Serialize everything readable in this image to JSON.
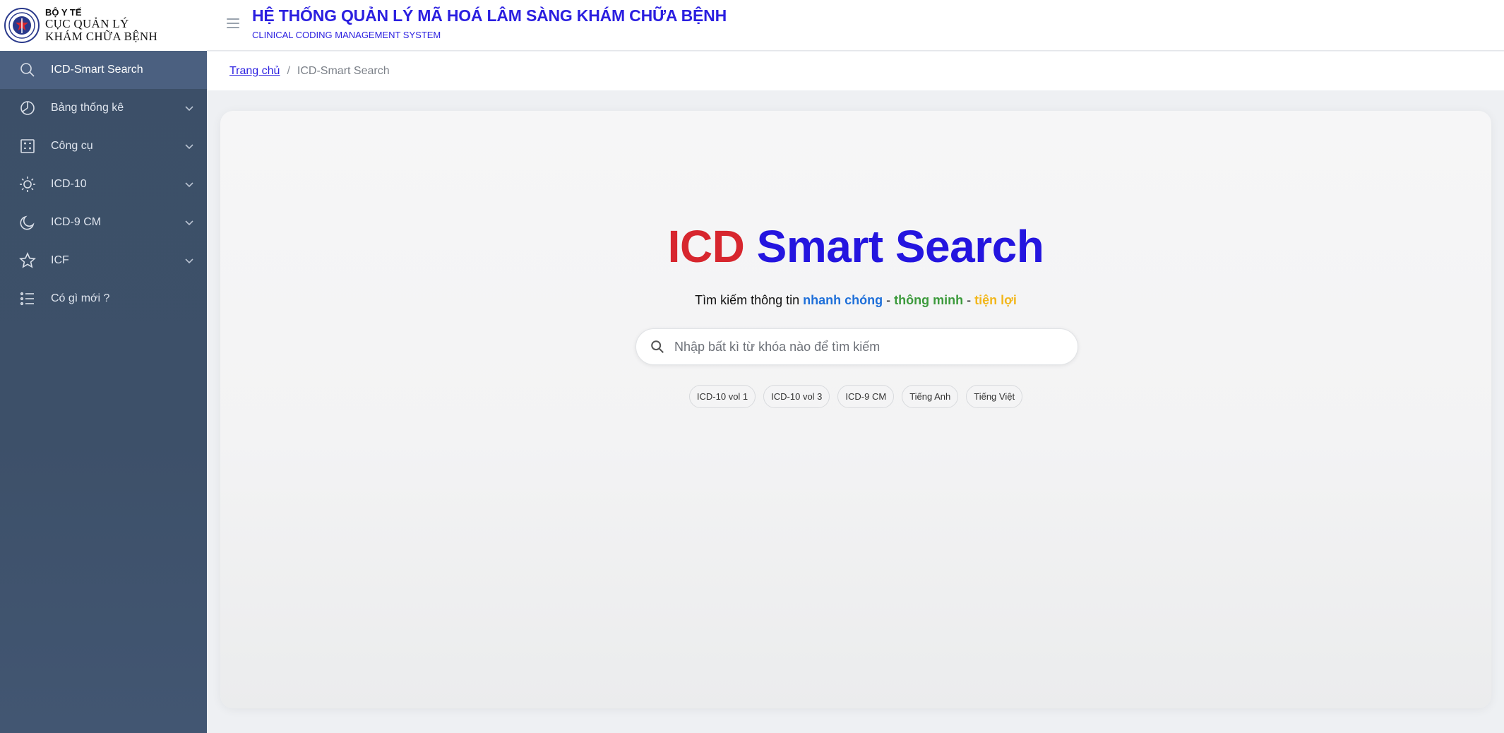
{
  "logo": {
    "line1": "BỘ Y TẾ",
    "line2": "CỤC QUẢN LÝ",
    "line3": "KHÁM CHỮA BỆNH"
  },
  "header": {
    "title": "HỆ THỐNG QUẢN LÝ MÃ HOÁ LÂM SÀNG KHÁM CHỮA BỆNH",
    "subtitle": "CLINICAL CODING MANAGEMENT SYSTEM"
  },
  "sidebar": {
    "items": [
      {
        "label": "ICD-Smart Search",
        "icon": "search-icon",
        "active": true,
        "expandable": false
      },
      {
        "label": "Bảng thống kê",
        "icon": "pie-chart-icon",
        "active": false,
        "expandable": true
      },
      {
        "label": "Công cụ",
        "icon": "tools-grid-icon",
        "active": false,
        "expandable": true
      },
      {
        "label": "ICD-10",
        "icon": "sun-icon",
        "active": false,
        "expandable": true
      },
      {
        "label": "ICD-9 CM",
        "icon": "moon-icon",
        "active": false,
        "expandable": true
      },
      {
        "label": "ICF",
        "icon": "star-icon",
        "active": false,
        "expandable": true
      },
      {
        "label": "Có gì mới ?",
        "icon": "list-icon",
        "active": false,
        "expandable": false
      }
    ]
  },
  "breadcrumb": {
    "home": "Trang chủ",
    "separator": "/",
    "current": "ICD-Smart Search"
  },
  "hero": {
    "title_part1": "ICD",
    "title_part2": "Smart Search",
    "tagline_prefix": "Tìm kiếm thông tin ",
    "tagline_word1": "nhanh chóng",
    "tagline_sep1": " - ",
    "tagline_word2": "thông minh",
    "tagline_sep2": " - ",
    "tagline_word3": "tiện lợi"
  },
  "search": {
    "placeholder": "Nhập bất kì từ khóa nào để tìm kiếm",
    "value": ""
  },
  "chips": [
    "ICD-10 vol 1",
    "ICD-10 vol 3",
    "ICD-9 CM",
    "Tiếng Anh",
    "Tiếng Việt"
  ],
  "colors": {
    "brand_blue": "#2b1fe0",
    "title_red": "#d7262e",
    "sidebar_bg": "#3c4f68",
    "tag_blue": "#1e6fd9",
    "tag_green": "#3c9a3c",
    "tag_yellow": "#f2b71c"
  }
}
